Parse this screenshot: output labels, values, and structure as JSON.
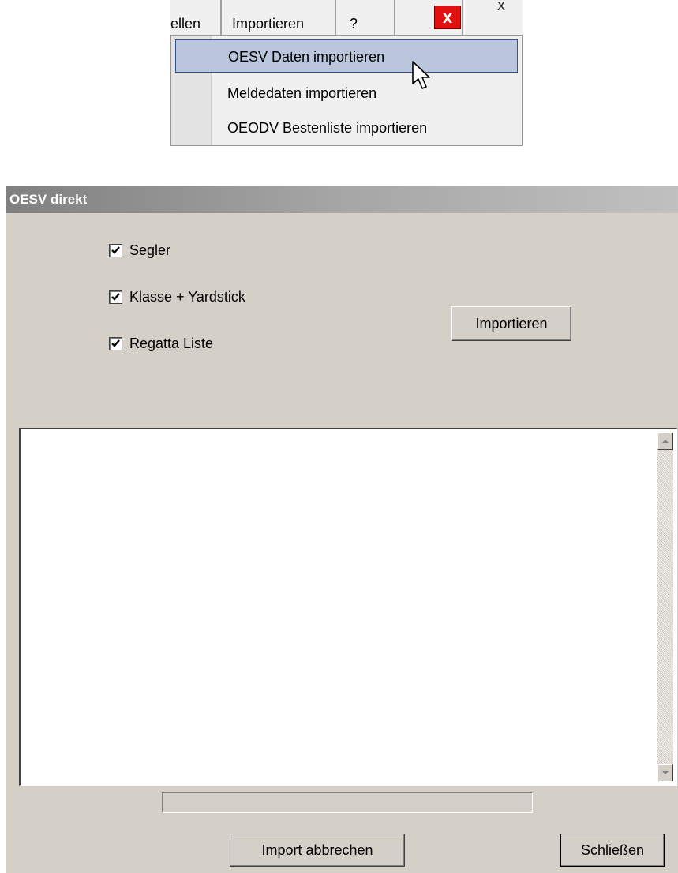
{
  "menubar": {
    "tab_partial": "ellen",
    "tab_import": "Importieren",
    "tab_help": "?",
    "close_red": "x",
    "close_small": "x"
  },
  "import_menu": {
    "items": [
      {
        "label": "OESV Daten importieren",
        "highlighted": true
      },
      {
        "label": "Meldedaten importieren",
        "highlighted": false
      },
      {
        "label": "OEODV Bestenliste importieren",
        "highlighted": false
      }
    ]
  },
  "dialog": {
    "title": "OESV direkt",
    "checkboxes": [
      {
        "label": "Segler",
        "checked": true
      },
      {
        "label": "Klasse + Yardstick",
        "checked": true
      },
      {
        "label": "Regatta Liste",
        "checked": true
      }
    ],
    "import_button": "Importieren",
    "log_text": "",
    "progress": 0,
    "abort_button": "Import abbrechen",
    "close_button": "Schließen"
  },
  "colors": {
    "dialog_bg": "#d4d0c8",
    "menu_highlight": "#b9c6db",
    "menu_highlight_border": "#32548a",
    "close_red": "#e01010"
  }
}
